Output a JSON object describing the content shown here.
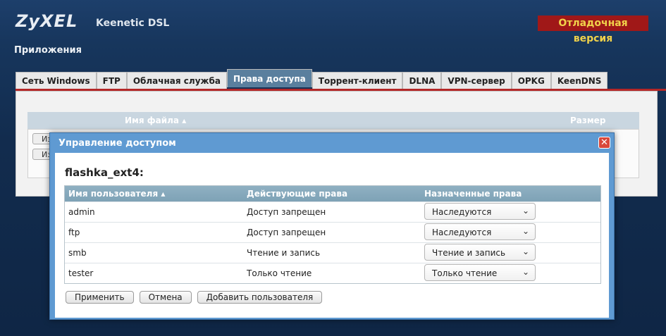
{
  "header": {
    "logo": "ZyXEL",
    "model": "Keenetic DSL",
    "debug_badge": "Отладочная версия",
    "section_title": "Приложения"
  },
  "tabs": [
    {
      "label": "Сеть Windows",
      "active": false
    },
    {
      "label": "FTP",
      "active": false
    },
    {
      "label": "Облачная служба",
      "active": false
    },
    {
      "label": "Права доступа",
      "active": true
    },
    {
      "label": "Торрент-клиент",
      "active": false
    },
    {
      "label": "DLNA",
      "active": false
    },
    {
      "label": "VPN-сервер",
      "active": false
    },
    {
      "label": "OPKG",
      "active": false
    },
    {
      "label": "KeenDNS",
      "active": false
    }
  ],
  "file_table": {
    "col_name": "Имя файла ▴",
    "col_size": "Размер",
    "row_buttons": [
      "Из",
      "Из"
    ]
  },
  "dialog": {
    "title": "Управление доступом",
    "folder": "flashka_ext4:",
    "columns": {
      "user": "Имя пользователя ▴",
      "effective": "Действующие права",
      "assigned": "Назначенные права"
    },
    "rows": [
      {
        "user": "admin",
        "effective": "Доступ запрещен",
        "assigned": "Наследуются"
      },
      {
        "user": "ftp",
        "effective": "Доступ запрещен",
        "assigned": "Наследуются"
      },
      {
        "user": "smb",
        "effective": "Чтение и запись",
        "assigned": "Чтение и запись"
      },
      {
        "user": "tester",
        "effective": "Только чтение",
        "assigned": "Только чтение"
      }
    ],
    "buttons": {
      "apply": "Применить",
      "cancel": "Отмена",
      "add_user": "Добавить пользователя"
    }
  },
  "colors": {
    "background": "#17365d",
    "accent_red": "#b42828",
    "badge_text": "#f1d24a",
    "dialog_frame": "#5f9ad2",
    "active_tab": "#5a7f9e"
  }
}
